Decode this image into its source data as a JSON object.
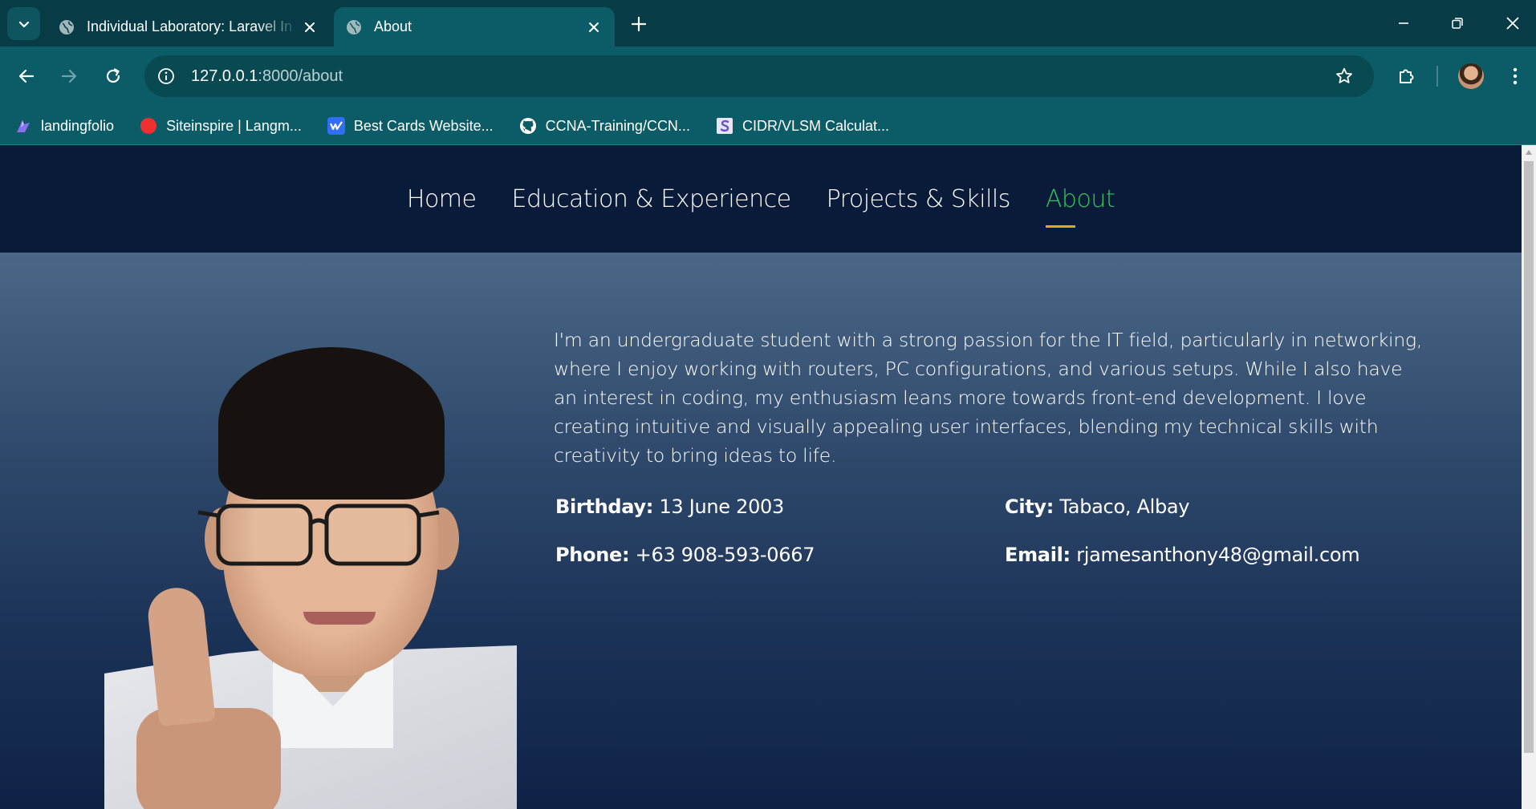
{
  "browser": {
    "tabs": [
      {
        "title": "Individual Laboratory: Laravel In",
        "active": false
      },
      {
        "title": "About",
        "active": true
      }
    ],
    "address": {
      "host": "127.0.0.1",
      "path": ":8000/about"
    },
    "bookmarks": [
      {
        "label": "landingfolio",
        "icon": "landingfolio-icon"
      },
      {
        "label": "Siteinspire | Langm...",
        "icon": "siteinspire-icon"
      },
      {
        "label": "Best Cards Website...",
        "icon": "webflow-icon"
      },
      {
        "label": "CCNA-Training/CCN...",
        "icon": "github-icon"
      },
      {
        "label": "CIDR/VLSM Calculat...",
        "icon": "calculator-icon"
      }
    ]
  },
  "site": {
    "nav": {
      "home": "Home",
      "education": "Education & Experience",
      "projects": "Projects & Skills",
      "about": "About"
    },
    "about": {
      "bio": "I'm an undergraduate student with a strong passion for the IT field, particularly in networking, where I enjoy working with routers, PC configurations, and various setups. While I also have an interest in coding, my enthusiasm leans more towards front-end development. I love creating intuitive and visually appealing user interfaces, blending my technical skills with creativity to bring ideas to life.",
      "birthday_label": "Birthday:",
      "birthday": "13 June 2003",
      "city_label": "City:",
      "city": "Tabaco, Albay",
      "phone_label": "Phone:",
      "phone": "+63 908-593-0667",
      "email_label": "Email:",
      "email": "rjamesanthony48@gmail.com"
    }
  },
  "colors": {
    "chrome_bg": "#073b45",
    "toolbar_bg": "#0b5c66",
    "site_nav_bg": "#0a1b3a",
    "nav_active": "#2ec55a",
    "nav_underline": "#e0a52c"
  }
}
